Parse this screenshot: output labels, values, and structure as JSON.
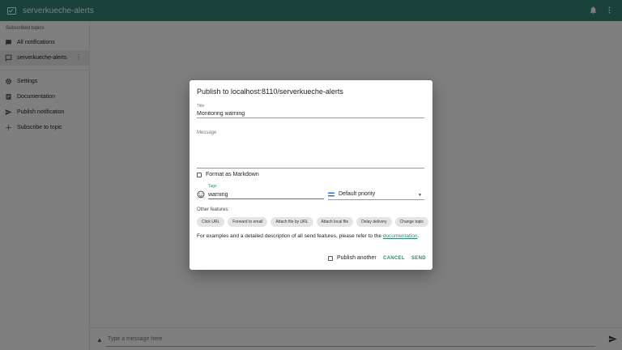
{
  "app": {
    "title": "serverkueche-alerts"
  },
  "sidebar": {
    "header": "Subscribed topics",
    "items": [
      {
        "label": "All notifications",
        "icon": "chat-icon"
      },
      {
        "label": "serverkueche-alerts",
        "icon": "message-outline-icon",
        "active": true
      },
      {
        "label": "Settings",
        "icon": "gear-icon"
      },
      {
        "label": "Documentation",
        "icon": "document-icon"
      },
      {
        "label": "Publish notification",
        "icon": "send-icon"
      },
      {
        "label": "Subscribe to topic",
        "icon": "plus-icon"
      }
    ]
  },
  "messagebar": {
    "placeholder": "Type a message here"
  },
  "dialog": {
    "title": "Publish to localhost:8110/serverkueche-alerts",
    "title_field": {
      "label": "Title",
      "value": "Monitoring warning"
    },
    "message_field": {
      "label": "Message",
      "value": ""
    },
    "markdown_label": "Format as Markdown",
    "tags_field": {
      "label": "Tags",
      "value": "warning"
    },
    "priority": {
      "value": "Default priority"
    },
    "other_features_label": "Other features:",
    "chips": [
      "Click URL",
      "Forward to email",
      "Attach file by URL",
      "Attach local file",
      "Delay delivery",
      "Change topic"
    ],
    "doc_text": "For examples and a detailed description of all send features, please refer to the ",
    "doc_link": "documentation",
    "doc_end": ".",
    "publish_another_label": "Publish another",
    "cancel_label": "CANCEL",
    "send_label": "SEND"
  },
  "colors": {
    "primary": "#338574"
  }
}
